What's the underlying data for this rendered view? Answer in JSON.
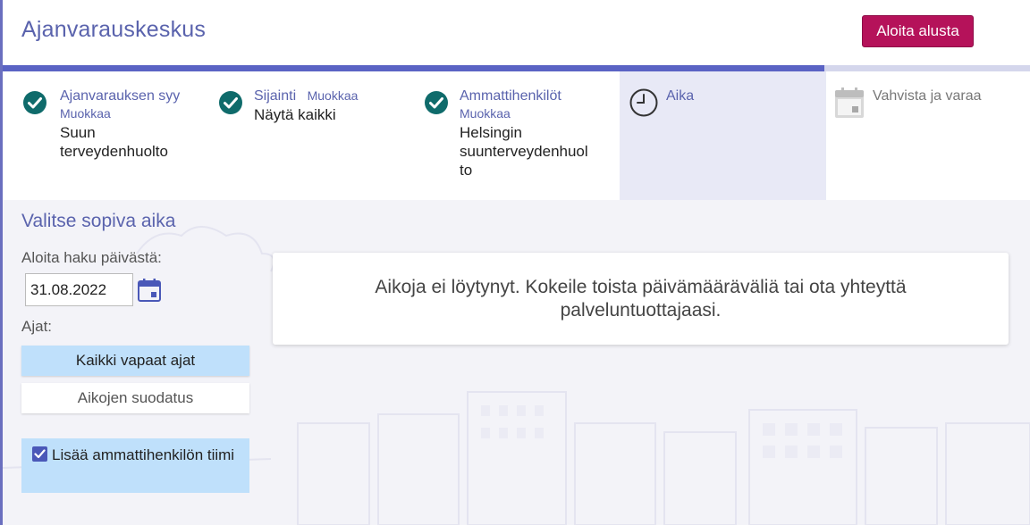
{
  "header": {
    "title": "Ajanvarauskeskus",
    "restart_label": "Aloita alusta"
  },
  "progress": {
    "fraction": 0.8
  },
  "steps": [
    {
      "label": "Ajanvarauksen syy",
      "edit": "Muokkaa",
      "value_lines": [
        "Suun",
        "terveydenhuolto"
      ],
      "status": "done"
    },
    {
      "label": "Sijainti",
      "edit": "Muokkaa",
      "value_lines": [
        "Näytä kaikki"
      ],
      "status": "done"
    },
    {
      "label": "Ammattihenkilöt",
      "edit": "Muokkaa",
      "value_lines": [
        "Helsingin",
        "suunterveydenhuol",
        "to"
      ],
      "status": "done"
    },
    {
      "label": "Aika",
      "status": "active"
    },
    {
      "label": "Vahvista ja varaa",
      "status": "pending"
    }
  ],
  "main": {
    "section_title": "Valitse sopiva aika",
    "start_date_label": "Aloita haku päivästä:",
    "start_date_value": "31.08.2022",
    "times_label": "Ajat:",
    "all_times_label": "Kaikki vapaat ajat",
    "filter_label": "Aikojen suodatus",
    "team_label": "Lisää ammattihenkilön tiimi",
    "team_checked": true,
    "no_results_message": "Aikoja ei löytynyt. Kokeile toista päivämääräväliä tai ota yhteyttä palveluntuottajaasi."
  },
  "colors": {
    "accent": "#5a63ad",
    "brand_button": "#b5125a",
    "done_check": "#0f6b6b",
    "selected_option": "#bfe0fb"
  },
  "icons": {
    "done": "check-circle-icon",
    "active": "clock-icon",
    "pending": "calendar-icon",
    "date_picker": "calendar-icon",
    "team_checkbox": "checkbox-checked-icon"
  }
}
